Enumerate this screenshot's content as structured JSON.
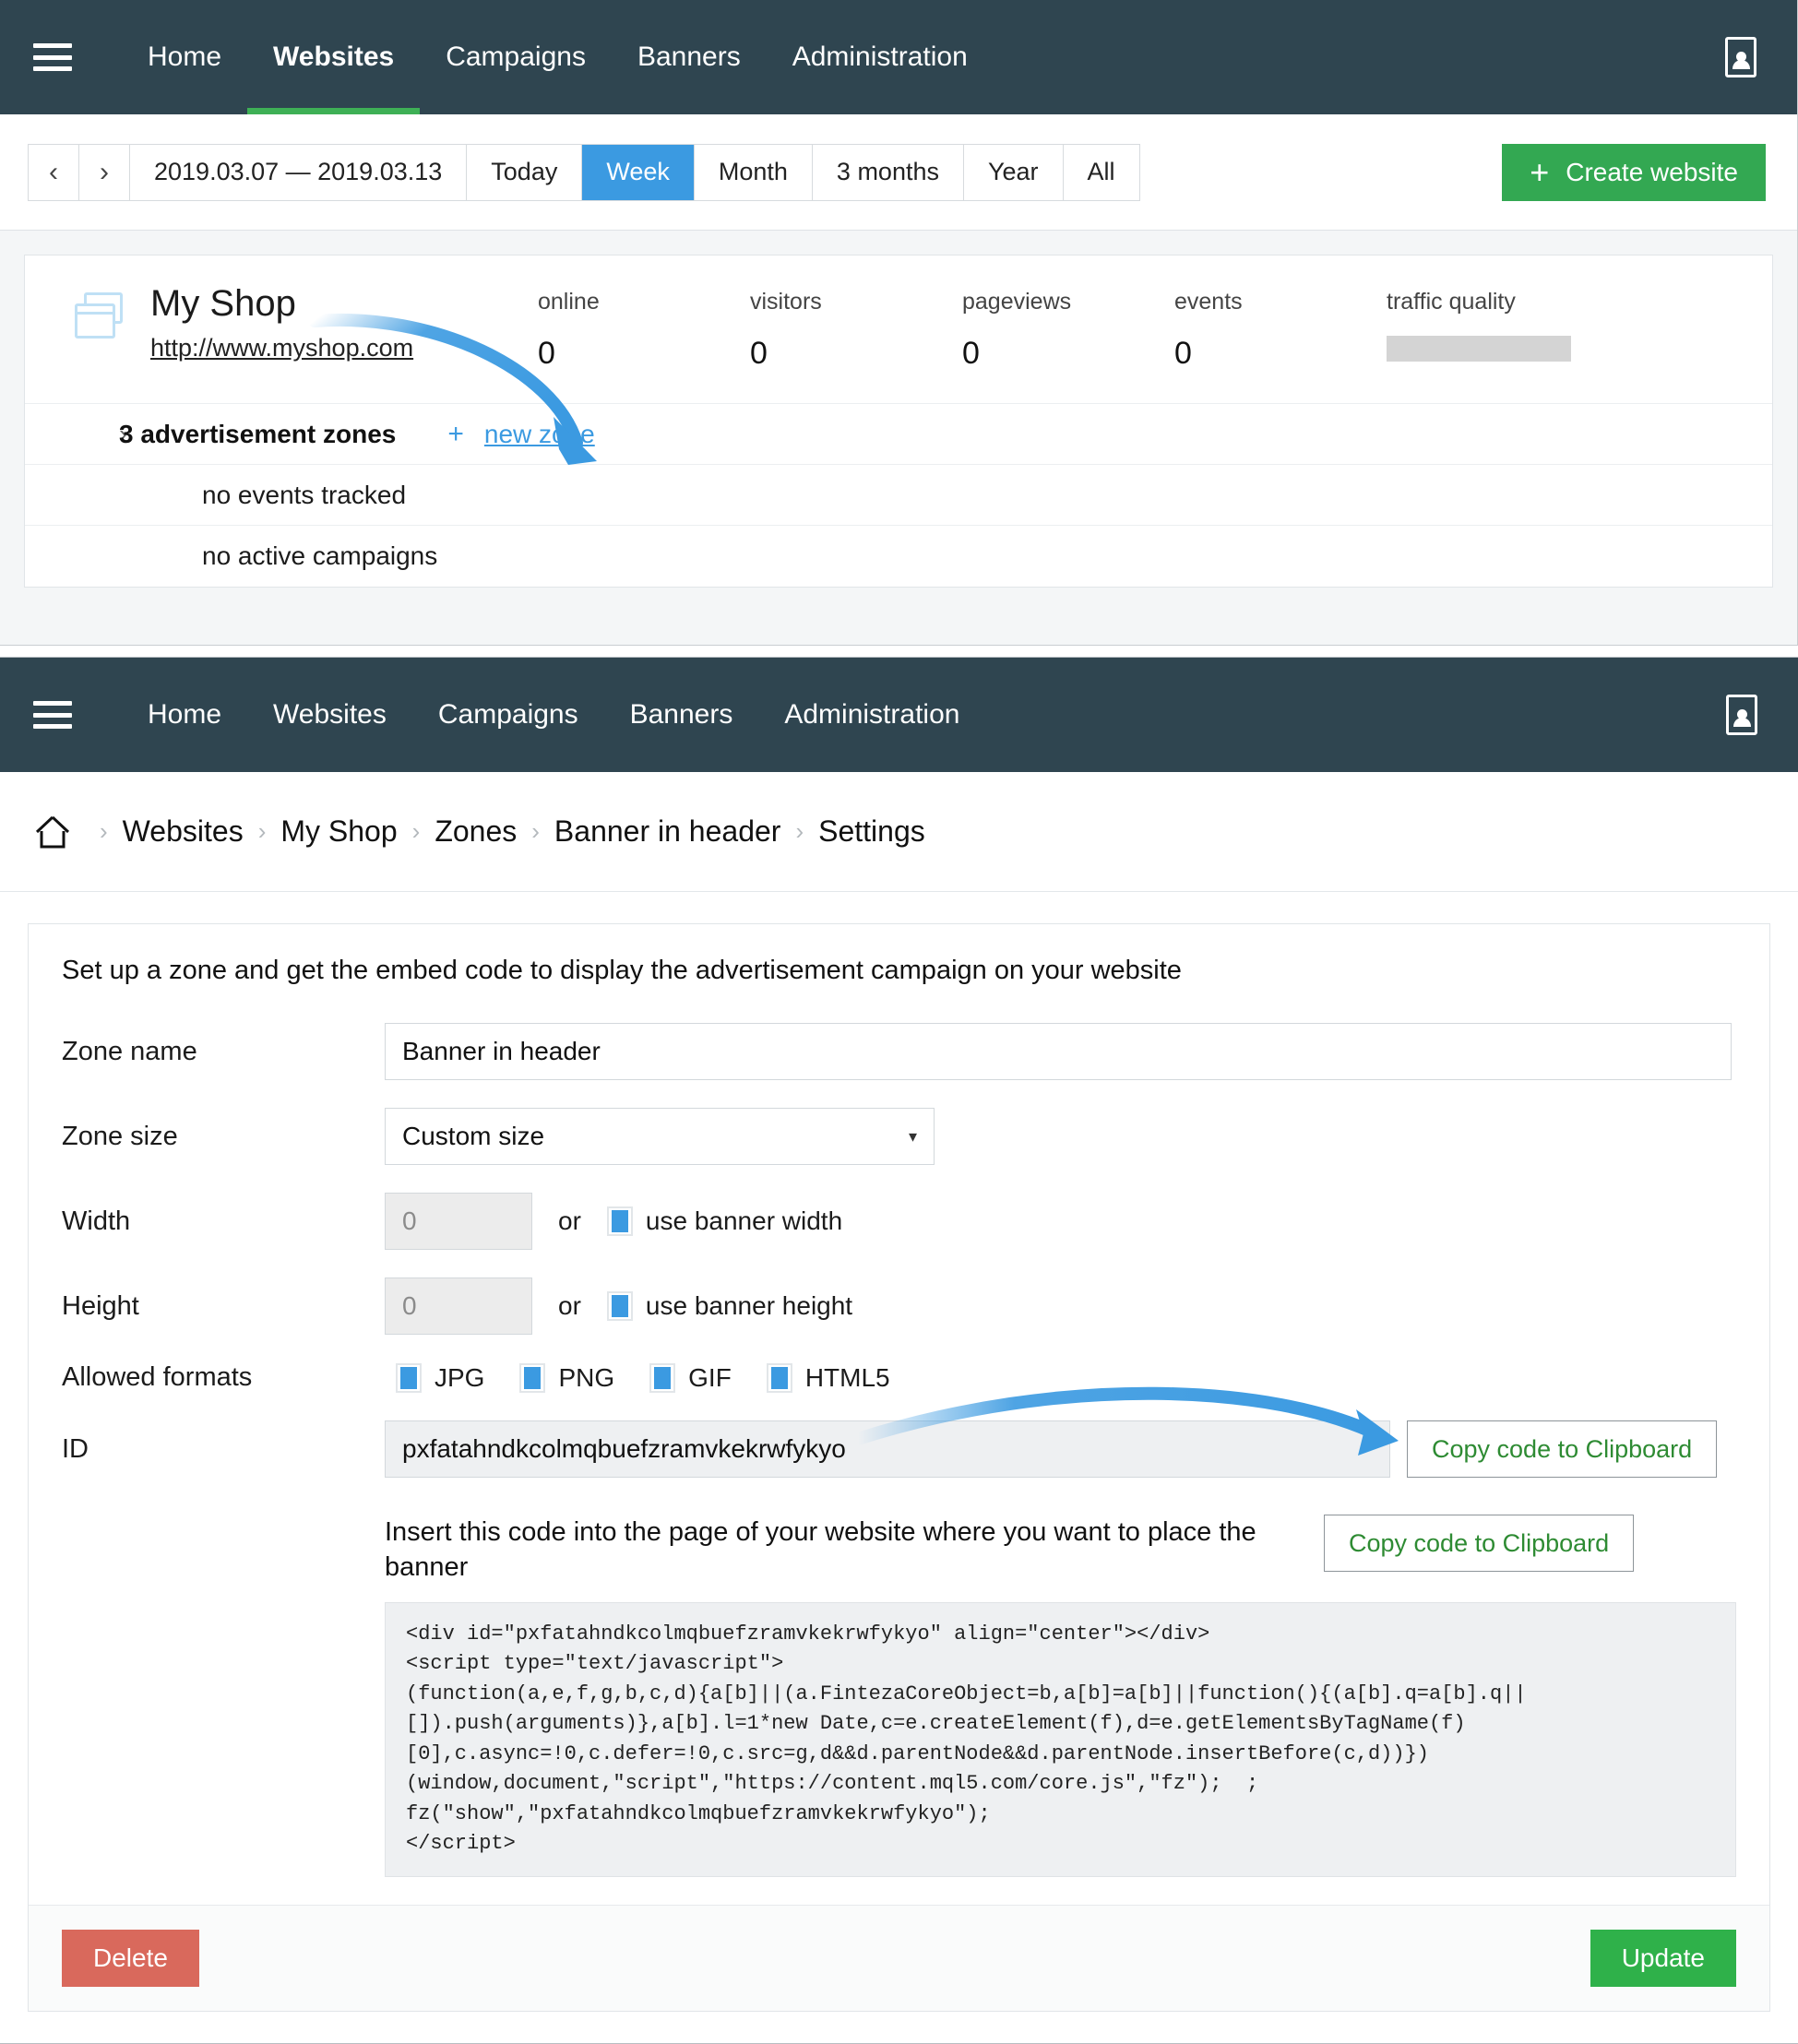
{
  "nav": {
    "menu_icon": "hamburger-icon",
    "profile_icon": "profile-icon",
    "items": [
      {
        "label": "Home",
        "active": false
      },
      {
        "label": "Websites",
        "active": true
      },
      {
        "label": "Campaigns",
        "active": false
      },
      {
        "label": "Banners",
        "active": false
      },
      {
        "label": "Administration",
        "active": false
      }
    ]
  },
  "toolbar": {
    "prev_label": "‹",
    "next_label": "›",
    "date_range": "2019.03.07  — 2019.03.13",
    "ranges": [
      {
        "label": "Today",
        "active": false
      },
      {
        "label": "Week",
        "active": true
      },
      {
        "label": "Month",
        "active": false
      },
      {
        "label": "3 months",
        "active": false
      },
      {
        "label": "Year",
        "active": false
      },
      {
        "label": "All",
        "active": false
      }
    ],
    "create_plus": "+",
    "create_label": "Create website"
  },
  "website_card": {
    "name": "My Shop",
    "url": "http://www.myshop.com",
    "stats": [
      {
        "label": "online",
        "value": "0"
      },
      {
        "label": "visitors",
        "value": "0"
      },
      {
        "label": "pageviews",
        "value": "0"
      },
      {
        "label": "events",
        "value": "0"
      }
    ],
    "traffic_quality_label": "traffic quality",
    "zones_chevron": "›",
    "zones_label": "3 advertisement zones",
    "new_zone_plus": "+",
    "new_zone_label": "new zone",
    "no_events": "no events tracked",
    "no_campaigns": "no active campaigns"
  },
  "breadcrumb": {
    "home_icon": "home-icon",
    "separator": "›",
    "items": [
      "Websites",
      "My Shop",
      "Zones",
      "Banner in header",
      "Settings"
    ]
  },
  "form": {
    "intro": "Set up a zone and get the embed code to display the advertisement campaign on your website",
    "zone_name_label": "Zone name",
    "zone_name_value": "Banner in header",
    "zone_size_label": "Zone size",
    "zone_size_value": "Custom size",
    "zone_size_caret": "▾",
    "width_label": "Width",
    "width_value": "0",
    "height_label": "Height",
    "height_value": "0",
    "or_label": "or",
    "use_banner_width": "use banner width",
    "use_banner_height": "use banner height",
    "allowed_formats_label": "Allowed formats",
    "formats": [
      {
        "label": "JPG",
        "checked": true
      },
      {
        "label": "PNG",
        "checked": true
      },
      {
        "label": "GIF",
        "checked": true
      },
      {
        "label": "HTML5",
        "checked": true
      }
    ],
    "id_label": "ID",
    "id_value": "pxfatahndkcolmqbuefzramvkekrwfykyo",
    "copy_id_label": "Copy code to Clipboard",
    "insert_text": "Insert this code into the page of your website where you want to place the banner",
    "copy_code_label": "Copy code to Clipboard",
    "embed_code": "<div id=\"pxfatahndkcolmqbuefzramvkekrwfykyo\" align=\"center\"></div>\n<script type=\"text/javascript\">\n(function(a,e,f,g,b,c,d){a[b]||(a.FintezaCoreObject=b,a[b]=a[b]||function(){(a[b].q=a[b].q||\n[]).push(arguments)},a[b].l=1*new Date,c=e.createElement(f),d=e.getElementsByTagName(f)\n[0],c.async=!0,c.defer=!0,c.src=g,d&&d.parentNode&&d.parentNode.insertBefore(c,d))})\n(window,document,\"script\",\"https://content.mql5.com/core.js\",\"fz\");  ;\nfz(\"show\",\"pxfatahndkcolmqbuefzramvkekrwfykyo\");\n</script>",
    "delete_label": "Delete",
    "update_label": "Update"
  },
  "annotations": {
    "arrow1": "curved-arrow-to-new-zone",
    "arrow2": "curved-arrow-to-copy-button"
  },
  "colors": {
    "navbar": "#2f4550",
    "accent_blue": "#3b9ae1",
    "green": "#33a852",
    "update_green": "#2fb14a",
    "delete_red": "#d9695c",
    "active_tab_underline": "#3eb056",
    "copy_text_green": "#2e8b33",
    "arrow_blue": "#3b9ae1"
  }
}
